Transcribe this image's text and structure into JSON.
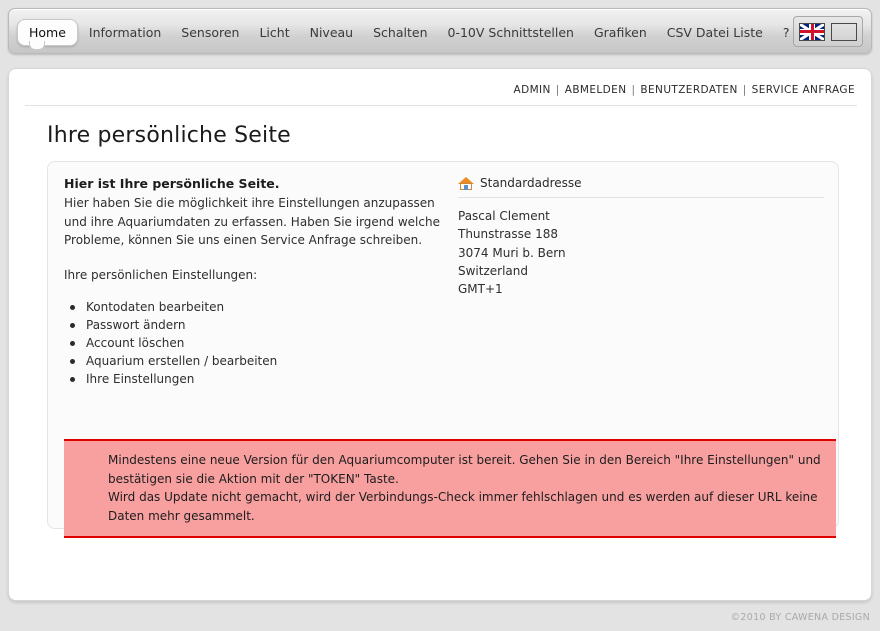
{
  "nav": {
    "tabs": [
      {
        "label": "Home",
        "active": true
      },
      {
        "label": "Information",
        "active": false
      },
      {
        "label": "Sensoren",
        "active": false
      },
      {
        "label": "Licht",
        "active": false
      },
      {
        "label": "Niveau",
        "active": false
      },
      {
        "label": "Schalten",
        "active": false
      },
      {
        "label": "0-10V Schnittstellen",
        "active": false
      },
      {
        "label": "Grafiken",
        "active": false
      },
      {
        "label": "CSV Datei Liste",
        "active": false
      },
      {
        "label": "?",
        "active": false
      }
    ],
    "languages": [
      {
        "name": "english-flag",
        "title": "English"
      },
      {
        "name": "german-flag",
        "title": "Deutsch"
      }
    ]
  },
  "userbar": {
    "links": [
      "ADMIN",
      "ABMELDEN",
      "BENUTZERDATEN",
      "SERVICE ANFRAGE"
    ],
    "separator": "|"
  },
  "page": {
    "title": "Ihre persönliche Seite"
  },
  "intro": {
    "heading": "Hier ist Ihre persönliche Seite.",
    "body": "Hier haben Sie die möglichkeit ihre Einstellungen anzupassen und ihre Aquariumdaten zu erfassen. Haben Sie irgend welche Probleme, können Sie uns einen Service Anfrage schreiben.",
    "subheading": "Ihre persönlichen Einstellungen:",
    "links": [
      "Kontodaten bearbeiten",
      "Passwort ändern",
      "Account löschen",
      "Aquarium erstellen / bearbeiten",
      "Ihre Einstellungen"
    ]
  },
  "address": {
    "icon": "house-icon",
    "heading": "Standardadresse",
    "lines": [
      "Pascal Clement",
      "Thunstrasse 188",
      "3074 Muri b. Bern",
      "Switzerland",
      "GMT+1"
    ]
  },
  "alert": {
    "line1": "Mindestens eine neue Version für den Aquariumcomputer ist bereit. Gehen Sie in den Bereich \"Ihre Einstellungen\" und bestätigen sie die Aktion mit der \"TOKEN\" Taste.",
    "line2": "Wird das Update nicht gemacht, wird der Verbindungs-Check immer fehlschlagen und es werden auf dieser URL keine Daten mehr gesammelt.",
    "background_color": "#f8a0a0",
    "border_color": "#e00000"
  },
  "footer": {
    "copyright": "©2010 BY CAWENA DESIGN"
  }
}
